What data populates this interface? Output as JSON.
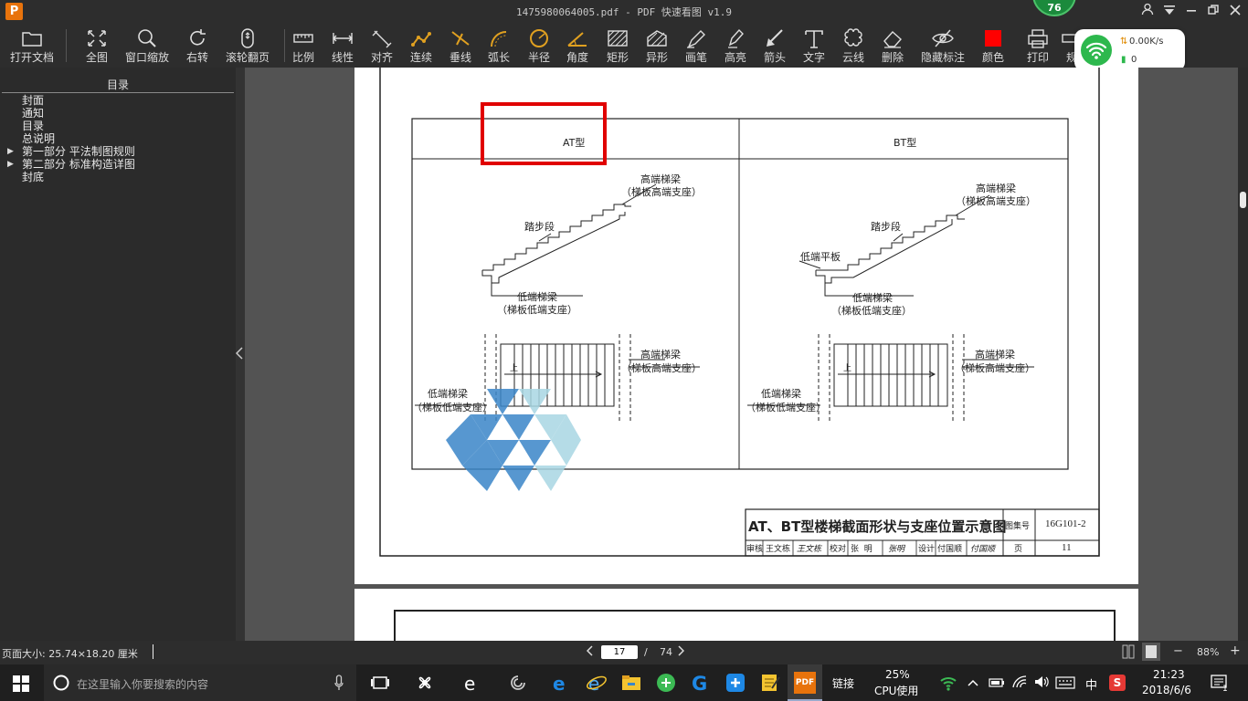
{
  "window": {
    "title": "1475980064005.pdf - PDF 快速看图 v1.9",
    "badge": "76",
    "logo": "P"
  },
  "toolbar": [
    {
      "label": "打开文档",
      "icon": "folder-icon"
    },
    {
      "label": "全图",
      "icon": "fullview-icon"
    },
    {
      "label": "窗口缩放",
      "icon": "zoom-window-icon"
    },
    {
      "label": "右转",
      "icon": "rotate-right-icon"
    },
    {
      "label": "滚轮翻页",
      "icon": "mouse-wheel-icon"
    },
    {
      "label": "比例",
      "icon": "scale-icon"
    },
    {
      "label": "线性",
      "icon": "linear-dim-icon"
    },
    {
      "label": "对齐",
      "icon": "aligned-dim-icon"
    },
    {
      "label": "连续",
      "icon": "continuous-dim-icon"
    },
    {
      "label": "垂线",
      "icon": "perpendicular-icon"
    },
    {
      "label": "弧长",
      "icon": "arc-length-icon"
    },
    {
      "label": "半径",
      "icon": "radius-icon"
    },
    {
      "label": "角度",
      "icon": "angle-icon"
    },
    {
      "label": "矩形",
      "icon": "rectangle-area-icon"
    },
    {
      "label": "异形",
      "icon": "polygon-area-icon"
    },
    {
      "label": "画笔",
      "icon": "pen-icon"
    },
    {
      "label": "高亮",
      "icon": "highlighter-icon"
    },
    {
      "label": "箭头",
      "icon": "arrow-icon"
    },
    {
      "label": "文字",
      "icon": "text-icon"
    },
    {
      "label": "云线",
      "icon": "cloud-line-icon"
    },
    {
      "label": "删除",
      "icon": "eraser-icon"
    },
    {
      "label": "隐藏标注",
      "icon": "hide-eye-icon"
    },
    {
      "label": "颜色",
      "icon": "color-swatch-icon"
    },
    {
      "label": "打印",
      "icon": "printer-icon"
    },
    {
      "label": "规",
      "icon": "ruler-icon"
    }
  ],
  "colors": {
    "accent_orange": "#e0a020",
    "swatch_red": "#ff0000",
    "highlight_box": "#e00000",
    "net_green": "#2db84d"
  },
  "sidebar": {
    "title": "目录",
    "items": [
      {
        "label": "封面",
        "expandable": false
      },
      {
        "label": "通知",
        "expandable": false
      },
      {
        "label": "目录",
        "expandable": false
      },
      {
        "label": "总说明",
        "expandable": false
      },
      {
        "label": "第一部分 平法制图规则",
        "expandable": true
      },
      {
        "label": "第二部分 标准构造详图",
        "expandable": true
      },
      {
        "label": "封底",
        "expandable": false
      }
    ]
  },
  "drawing": {
    "col_at": "AT型",
    "col_bt": "BT型",
    "high_beam": "高端梯梁",
    "high_support": "（梯板高端支座）",
    "step_segment": "踏步段",
    "low_beam": "低端梯梁",
    "low_support": "（梯板低端支座）",
    "low_slab": "低端平板",
    "up_mark": "上",
    "title_block": {
      "title": "AT、BT型楼梯截面形状与支座位置示意图",
      "atlas_label": "图集号",
      "atlas_no": "16G101-2",
      "review": "审核",
      "reviewer": "王文栋",
      "review_sig": "王文栋",
      "check": "校对",
      "checker": "张  明",
      "check_sig": "张明",
      "design": "设计",
      "designer": "付国顺",
      "design_sig": "付国顺",
      "page_label": "页",
      "page_no": "11"
    }
  },
  "statusbar": {
    "page_size": "页面大小: 25.74×18.20 厘米",
    "current_page": "17",
    "separator": "/",
    "total_pages": "74",
    "zoom": "88%",
    "minus": "−",
    "plus": "+"
  },
  "netwidget": {
    "speed": "0.00K/s",
    "count": "0"
  },
  "taskbar": {
    "search_placeholder": "在这里输入你要搜索的内容",
    "link_label": "链接",
    "cpu_percent": "25%",
    "cpu_label": "CPU使用",
    "ime": "中",
    "time": "21:23",
    "date": "2018/6/6",
    "notifications": "1"
  }
}
